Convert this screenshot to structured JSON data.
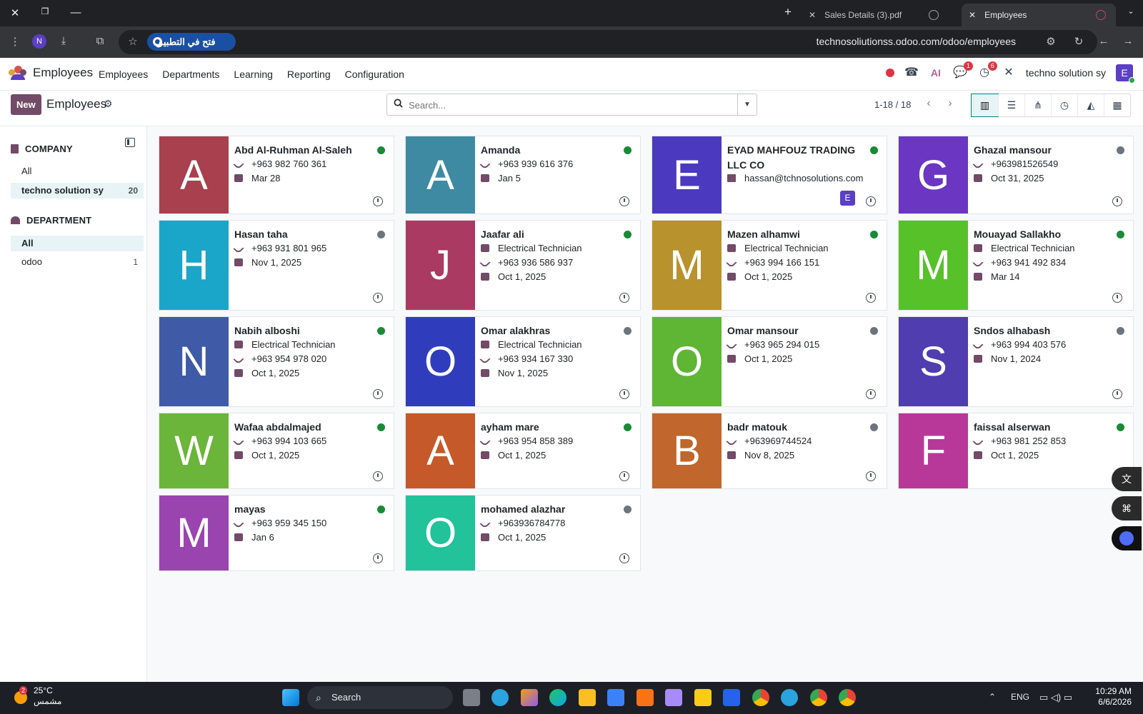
{
  "browser": {
    "tabs": [
      {
        "label": "Sales Details (3).pdf",
        "active": false
      },
      {
        "label": "Employees",
        "active": true
      }
    ],
    "open_in_app_label": "فتح في التطبيق",
    "url": "technosoliutionss.odoo.com/odoo/employees",
    "profile_initial": "N"
  },
  "navbar": {
    "app_name": "Employees",
    "menu": [
      "Employees",
      "Departments",
      "Learning",
      "Reporting",
      "Configuration"
    ],
    "discuss_badge": "1",
    "activity_badge": "6",
    "company_name": "techno solution sy",
    "user_initial": "E"
  },
  "control": {
    "new_label": "New",
    "title": "Employees",
    "search_placeholder": "Search...",
    "pager": "1-18 / 18"
  },
  "sidebar": {
    "company_heading": "COMPANY",
    "company_items": [
      {
        "label": "All",
        "count": ""
      },
      {
        "label": "techno solution sy",
        "count": "20"
      }
    ],
    "department_heading": "DEPARTMENT",
    "department_items": [
      {
        "label": "All",
        "count": ""
      },
      {
        "label": "odoo",
        "count": "1"
      }
    ]
  },
  "employees": [
    {
      "initial": "A",
      "color": "#a8404d",
      "name": "Abd Al-Ruhman Al-Saleh",
      "job": "",
      "phone": "+963 982 760 361",
      "email": "",
      "date": "Mar 28",
      "status": "#198a36"
    },
    {
      "initial": "A",
      "color": "#3f8aa3",
      "name": "Amanda",
      "job": "",
      "phone": "+963 939 616 376",
      "email": "",
      "date": "Jan 5",
      "status": "#198a36"
    },
    {
      "initial": "E",
      "color": "#4b39c0",
      "name": "EYAD MAHFOUZ TRADING LLC CO",
      "job": "",
      "phone": "",
      "email": "hassan@tchnosolutions.com",
      "date": "",
      "status": "#198a36",
      "mini": "E"
    },
    {
      "initial": "G",
      "color": "#6a36c2",
      "name": "Ghazal mansour",
      "job": "",
      "phone": "+963981526549",
      "email": "",
      "date": "Oct 31, 2025",
      "status": "#6c757d"
    },
    {
      "initial": "H",
      "color": "#1aa6c9",
      "name": "Hasan taha",
      "job": "",
      "phone": "+963 931 801 965",
      "email": "",
      "date": "Nov 1, 2025",
      "status": "#6c757d"
    },
    {
      "initial": "J",
      "color": "#aa3a62",
      "name": "Jaafar ali",
      "job": "Electrical Technician",
      "phone": "+963 936 586 937",
      "email": "",
      "date": "Oct 1, 2025",
      "status": "#198a36"
    },
    {
      "initial": "M",
      "color": "#b8922c",
      "name": "Mazen alhamwi",
      "job": "Electrical Technician",
      "phone": "+963 994 166 151",
      "email": "",
      "date": "Oct 1, 2025",
      "status": "#198a36"
    },
    {
      "initial": "M",
      "color": "#57c12a",
      "name": "Mouayad Sallakho",
      "job": "Electrical Technician",
      "phone": "+963 941 492 834",
      "email": "",
      "date": "Mar 14",
      "status": "#198a36"
    },
    {
      "initial": "N",
      "color": "#3f5aa6",
      "name": "Nabih alboshi",
      "job": "Electrical Technician",
      "phone": "+963 954 978 020",
      "email": "",
      "date": "Oct 1, 2025",
      "status": "#198a36"
    },
    {
      "initial": "O",
      "color": "#2f3dbd",
      "name": "Omar alakhras",
      "job": "Electrical Technician",
      "phone": "+963 934 167 330",
      "email": "",
      "date": "Nov 1, 2025",
      "status": "#6c757d"
    },
    {
      "initial": "O",
      "color": "#5fb534",
      "name": "Omar mansour",
      "job": "",
      "phone": "+963 965 294 015",
      "email": "",
      "date": "Oct 1, 2025",
      "status": "#6c757d"
    },
    {
      "initial": "S",
      "color": "#503db0",
      "name": "Sndos alhabash",
      "job": "",
      "phone": "+963 994 403 576",
      "email": "",
      "date": "Nov 1, 2024",
      "status": "#6c757d"
    },
    {
      "initial": "W",
      "color": "#6ab53a",
      "name": "Wafaa abdalmajed",
      "job": "",
      "phone": "+963 994 103 665",
      "email": "",
      "date": "Oct 1, 2025",
      "status": "#198a36"
    },
    {
      "initial": "A",
      "color": "#c5592a",
      "name": "ayham mare",
      "job": "",
      "phone": "+963 954 858 389",
      "email": "",
      "date": "Oct 1, 2025",
      "status": "#198a36"
    },
    {
      "initial": "B",
      "color": "#c1662c",
      "name": "badr matouk",
      "job": "",
      "phone": "+963969744524",
      "email": "",
      "date": "Nov 8, 2025",
      "status": "#6c757d"
    },
    {
      "initial": "F",
      "color": "#b8389a",
      "name": "faissal alserwan",
      "job": "",
      "phone": "+963 981 252 853",
      "email": "",
      "date": "Oct 1, 2025",
      "status": "#198a36"
    },
    {
      "initial": "M",
      "color": "#9a44b0",
      "name": "mayas",
      "job": "",
      "phone": "+963 959 345 150",
      "email": "",
      "date": "Jan 6",
      "status": "#198a36"
    },
    {
      "initial": "O",
      "color": "#22c29a",
      "name": "mohamed alazhar",
      "job": "",
      "phone": "+963936784778",
      "email": "",
      "date": "Oct 1, 2025",
      "status": "#6c757d"
    }
  ],
  "taskbar": {
    "weather_badge": "2",
    "temperature": "25°C",
    "weather_label": "مشمس",
    "search_label": "Search",
    "language": "ENG",
    "time": "10:29 AM",
    "date": "6/6/2026"
  }
}
